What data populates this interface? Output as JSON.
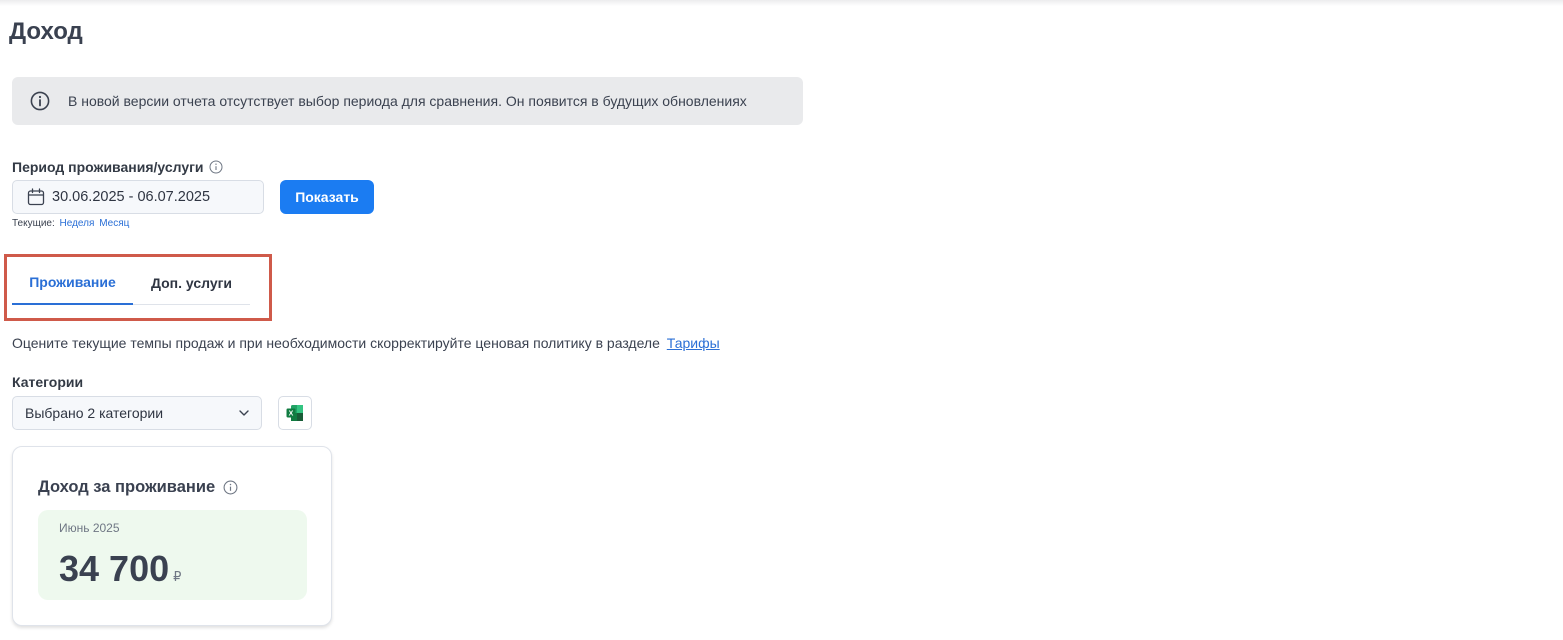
{
  "page": {
    "title": "Доход"
  },
  "notice": {
    "text": "В новой версии отчета отсутствует выбор периода для сравнения. Он появится в будущих обновлениях"
  },
  "period": {
    "label": "Период проживания/услуги",
    "value": "30.06.2025 - 06.07.2025",
    "show_button": "Показать",
    "presets_label": "Текущие:",
    "presets": [
      "Неделя",
      "Месяц"
    ]
  },
  "tabs": [
    {
      "label": "Проживание",
      "active": true
    },
    {
      "label": "Доп. услуги",
      "active": false
    }
  ],
  "hint": {
    "text": "Оцените текущие темпы продаж и при необходимости скорректируйте ценовая политику в разделе",
    "link": "Тарифы"
  },
  "categories": {
    "label": "Категории",
    "selected": "Выбрано 2 категории"
  },
  "income_card": {
    "title": "Доход за проживание",
    "month": "Июнь 2025",
    "amount": "34 700",
    "currency": "₽"
  },
  "colors": {
    "accent": "#1b7cf2",
    "highlight_box": "#cf5a4a",
    "card_bg": "#eef9ee"
  }
}
